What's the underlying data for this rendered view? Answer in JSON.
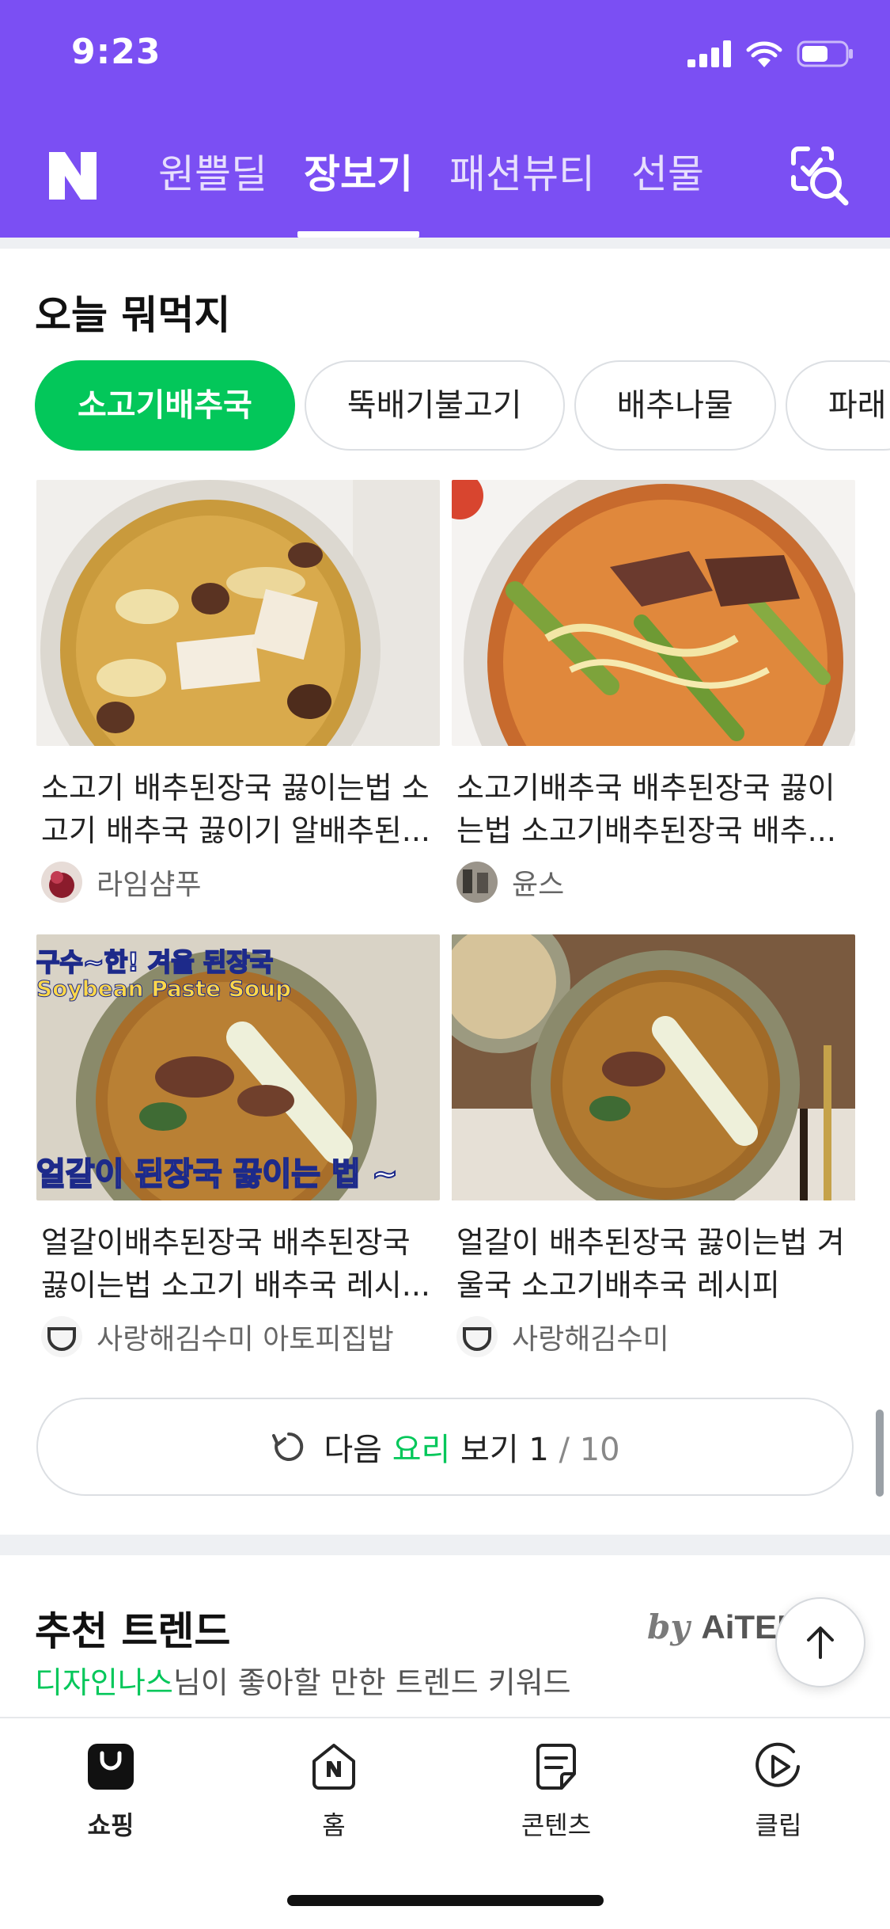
{
  "status_bar": {
    "time": "9:23"
  },
  "header": {
    "logo": "N",
    "tabs": [
      {
        "label": "원쁠딜",
        "active": false
      },
      {
        "label": "장보기",
        "active": true
      },
      {
        "label": "패션뷰티",
        "active": false
      },
      {
        "label": "선물",
        "active": false
      }
    ]
  },
  "today": {
    "title": "오늘 뭐먹지",
    "chips": [
      {
        "label": "소고기배추국",
        "active": true
      },
      {
        "label": "뚝배기불고기",
        "active": false
      },
      {
        "label": "배추나물",
        "active": false
      },
      {
        "label": "파래",
        "active": false
      }
    ],
    "recipes": [
      {
        "title": "소고기 배추된장국 끓이는법 소고기 배추국 끓이기 알배추된...",
        "author": "라임샴푸"
      },
      {
        "title": "소고기배추국 배추된장국 끓이는법 소고기배추된장국 배추...",
        "author": "윤스"
      },
      {
        "title": "얼갈이배추된장국 배추된장국 끓이는법 소고기 배추국 레시...",
        "author": "사랑해김수미 아토피집밥",
        "thumb_text_top": "구수~한! 겨울 된장국",
        "thumb_text_en": "Soybean Paste Soup",
        "thumb_text_bottom": "얼갈이 된장국 끓이는 법 ~"
      },
      {
        "title": "얼갈이 배추된장국 끓이는법 겨울국 소고기배추국 레시피",
        "author": "사랑해김수미"
      }
    ],
    "more": {
      "prefix": "다음 ",
      "highlight": "요리",
      "suffix": " 보기 ",
      "current": "1",
      "total": "/ 10"
    }
  },
  "trend": {
    "title": "추천 트렌드",
    "by": "by",
    "brand": "AiTEMS",
    "user": "디자인나스",
    "subtitle_rest": "님이 좋아할 만한 트렌드 키워드"
  },
  "bottom_nav": [
    {
      "label": "쇼핑",
      "active": true
    },
    {
      "label": "홈",
      "active": false
    },
    {
      "label": "콘텐츠",
      "active": false
    },
    {
      "label": "클립",
      "active": false
    }
  ],
  "colors": {
    "brand_purple": "#7b4ff3",
    "naver_green": "#03c75a"
  }
}
